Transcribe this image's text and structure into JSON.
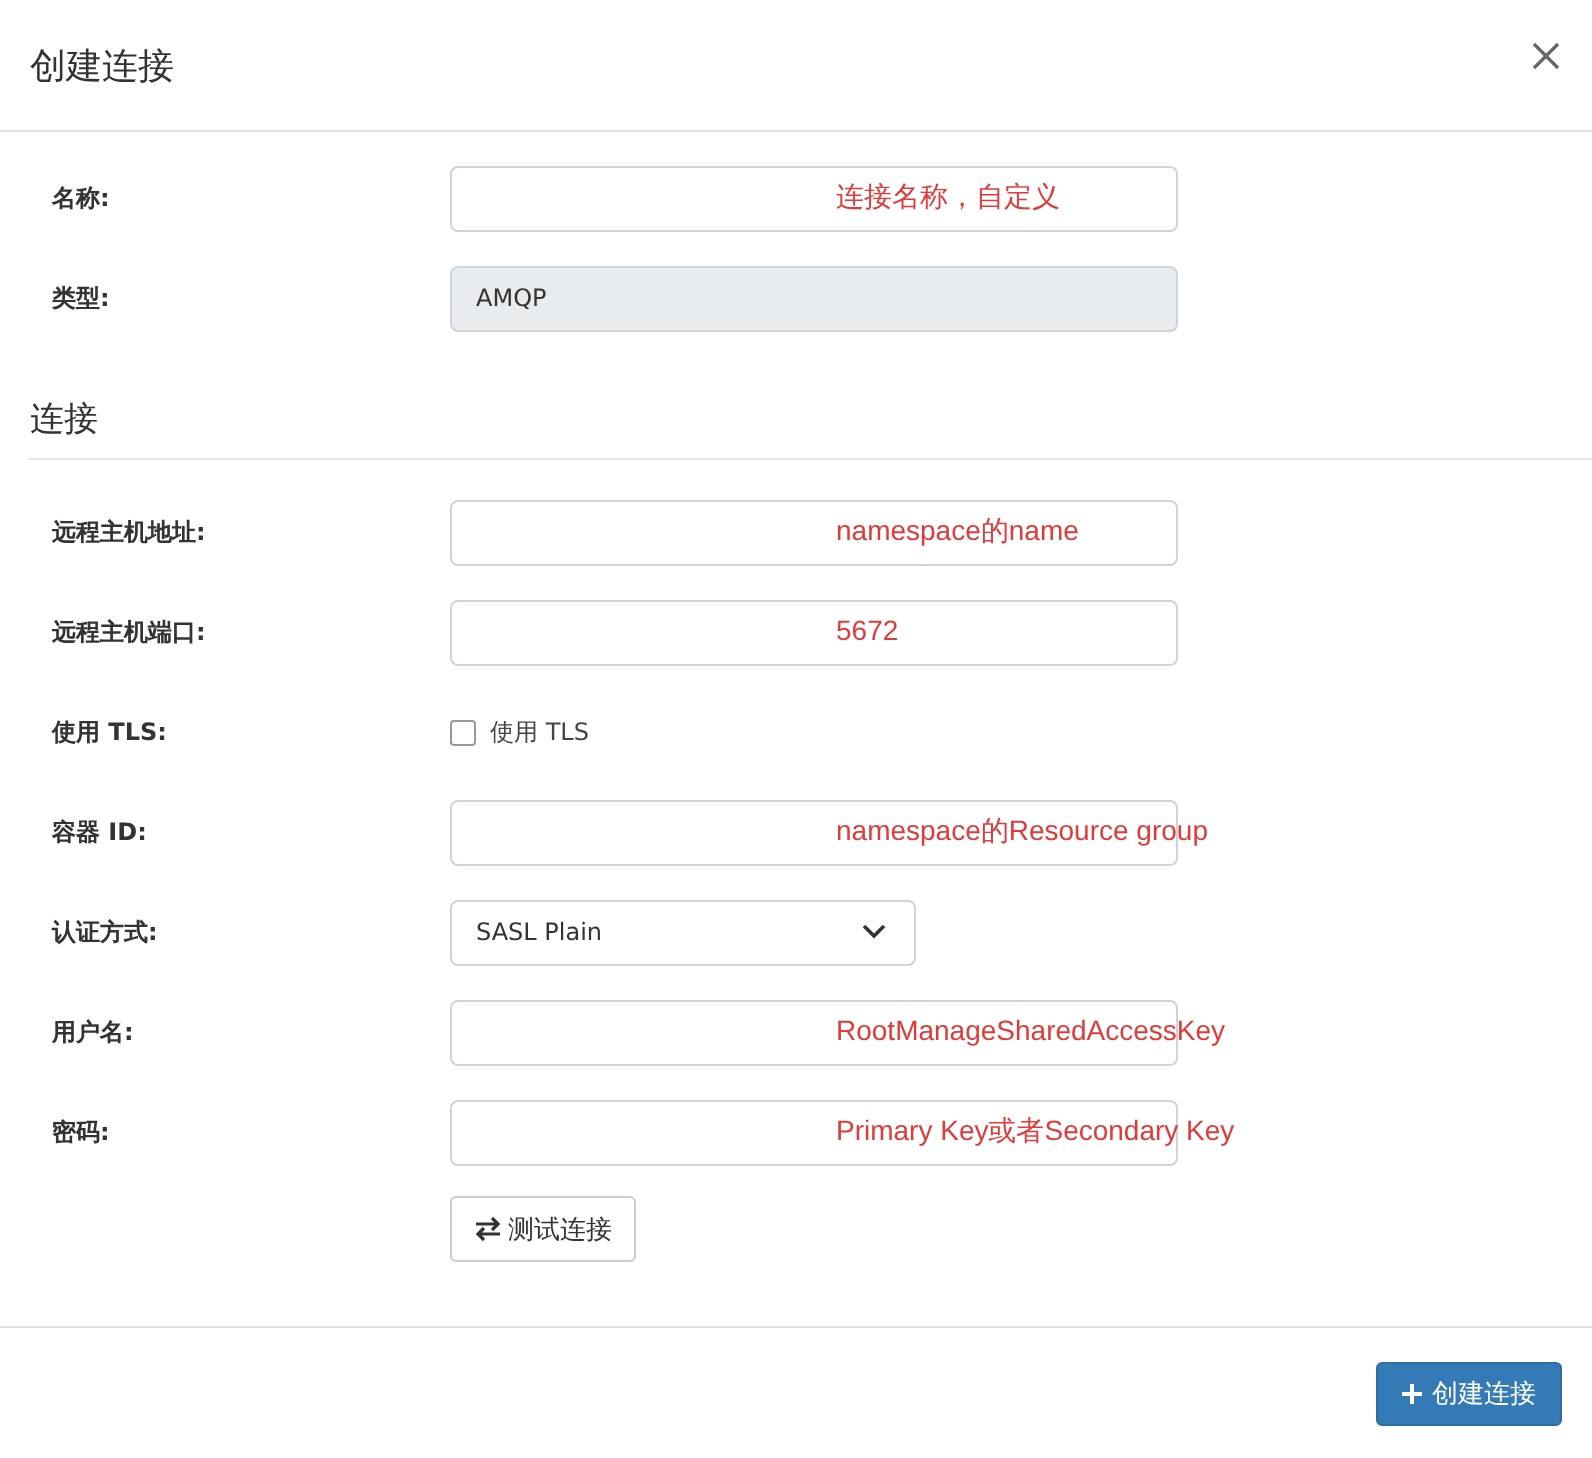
{
  "dialog": {
    "title": "创建连接"
  },
  "general_fields": [
    {
      "kind": "input",
      "label": "名称:",
      "annotation": "连接名称，自定义"
    },
    {
      "kind": "readonly",
      "label": "类型:",
      "value": "AMQP"
    }
  ],
  "connection_section": {
    "heading": "连接",
    "fields": [
      {
        "kind": "input",
        "label": "远程主机地址:",
        "annotation": "namespace的name"
      },
      {
        "kind": "input",
        "label": "远程主机端口:",
        "annotation": "5672"
      },
      {
        "kind": "checkbox",
        "label": "使用 TLS:",
        "option": "使用 TLS",
        "checked": false
      },
      {
        "kind": "input",
        "label": "容器 ID:",
        "annotation": "namespace的Resource group"
      },
      {
        "kind": "select",
        "label": "认证方式:",
        "value": "SASL Plain"
      },
      {
        "kind": "input",
        "label": "用户名:",
        "annotation": "RootManageSharedAccessKey"
      },
      {
        "kind": "input",
        "label": "密码:",
        "annotation": "Primary Key或者Secondary Key"
      }
    ],
    "test_button": "测试连接"
  },
  "footer": {
    "create_button": "创建连接"
  }
}
